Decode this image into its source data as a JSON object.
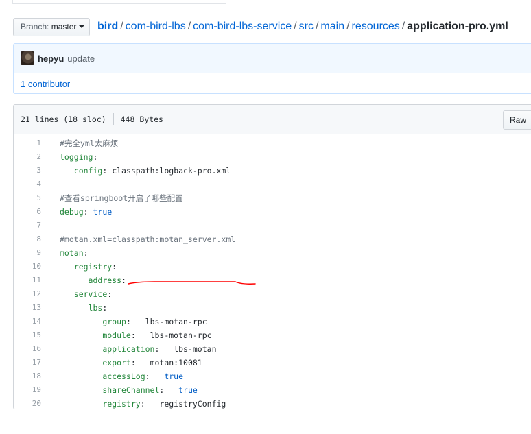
{
  "branch": {
    "label": "Branch:",
    "name": "master"
  },
  "breadcrumb": {
    "root": "bird",
    "parts": [
      "com-bird-lbs",
      "com-bird-lbs-service",
      "src",
      "main",
      "resources"
    ],
    "separator": "/",
    "file": "application-pro.yml"
  },
  "commit": {
    "author": "hepyu",
    "message": "update"
  },
  "contributors": {
    "text": "1 contributor"
  },
  "file_info": {
    "lines": "21 lines (18 sloc)",
    "size": "448 Bytes",
    "raw_label": "Raw"
  },
  "code_lines": [
    {
      "num": "1",
      "indent": "",
      "key": "",
      "sep": "",
      "value": "",
      "comment": "#完全yml太麻烦",
      "value_type": ""
    },
    {
      "num": "2",
      "indent": "",
      "key": "logging",
      "sep": ":",
      "value": "",
      "comment": "",
      "value_type": ""
    },
    {
      "num": "3",
      "indent": "   ",
      "key": "config",
      "sep": ": ",
      "value": "classpath:logback-pro.xml",
      "comment": "",
      "value_type": "str"
    },
    {
      "num": "4",
      "indent": "",
      "key": "",
      "sep": "",
      "value": "",
      "comment": "",
      "value_type": ""
    },
    {
      "num": "5",
      "indent": "",
      "key": "",
      "sep": "",
      "value": "",
      "comment": "#查看springboot开启了哪些配置",
      "value_type": ""
    },
    {
      "num": "6",
      "indent": "",
      "key": "debug",
      "sep": ": ",
      "value": "true",
      "comment": "",
      "value_type": "bool"
    },
    {
      "num": "7",
      "indent": "",
      "key": "",
      "sep": "",
      "value": "",
      "comment": "",
      "value_type": ""
    },
    {
      "num": "8",
      "indent": "",
      "key": "",
      "sep": "",
      "value": "",
      "comment": "#motan.xml=classpath:motan_server.xml",
      "value_type": ""
    },
    {
      "num": "9",
      "indent": "",
      "key": "motan",
      "sep": ":",
      "value": "",
      "comment": "",
      "value_type": ""
    },
    {
      "num": "10",
      "indent": "   ",
      "key": "registry",
      "sep": ":",
      "value": "",
      "comment": "",
      "value_type": ""
    },
    {
      "num": "11",
      "indent": "      ",
      "key": "address",
      "sep": ":",
      "value": "",
      "comment": "",
      "value_type": ""
    },
    {
      "num": "12",
      "indent": "   ",
      "key": "service",
      "sep": ":",
      "value": "",
      "comment": "",
      "value_type": ""
    },
    {
      "num": "13",
      "indent": "      ",
      "key": "lbs",
      "sep": ":",
      "value": "",
      "comment": "",
      "value_type": ""
    },
    {
      "num": "14",
      "indent": "         ",
      "key": "group",
      "sep": ":   ",
      "value": "lbs-motan-rpc",
      "comment": "",
      "value_type": "str"
    },
    {
      "num": "15",
      "indent": "         ",
      "key": "module",
      "sep": ":   ",
      "value": "lbs-motan-rpc",
      "comment": "",
      "value_type": "str"
    },
    {
      "num": "16",
      "indent": "         ",
      "key": "application",
      "sep": ":   ",
      "value": "lbs-motan",
      "comment": "",
      "value_type": "str"
    },
    {
      "num": "17",
      "indent": "         ",
      "key": "export",
      "sep": ":   ",
      "value": "motan:10081",
      "comment": "",
      "value_type": "str"
    },
    {
      "num": "18",
      "indent": "         ",
      "key": "accessLog",
      "sep": ":   ",
      "value": "true",
      "comment": "",
      "value_type": "bool"
    },
    {
      "num": "19",
      "indent": "         ",
      "key": "shareChannel",
      "sep": ":   ",
      "value": "true",
      "comment": "",
      "value_type": "bool"
    },
    {
      "num": "20",
      "indent": "         ",
      "key": "registry",
      "sep": ":   ",
      "value": "registryConfig",
      "comment": "",
      "value_type": "str"
    }
  ],
  "colors": {
    "link": "#0366d6",
    "key": "#22863a",
    "bool": "#005cc5",
    "comment": "#6a737d",
    "annotation": "#ff0000"
  }
}
